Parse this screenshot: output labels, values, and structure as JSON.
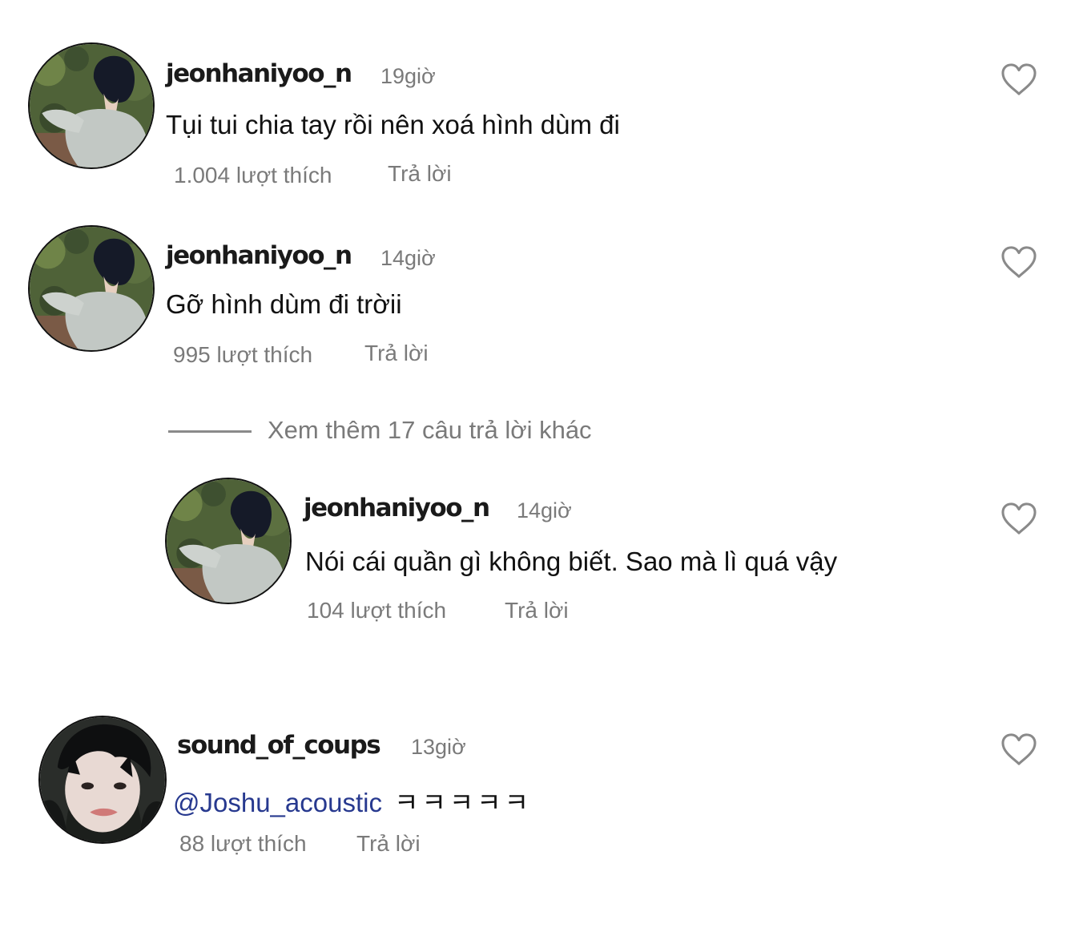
{
  "comments": [
    {
      "username": "jeonhaniyoo_n",
      "time": "19giờ",
      "text": "Tụi tui chia tay rồi nên xoá hình dùm đi",
      "likes": "1.004 lượt thích",
      "reply": "Trả lời",
      "avatar_icon": "avatar-photo-person-in-sweater",
      "like_icon": "heart-outline-icon"
    },
    {
      "username": "jeonhaniyoo_n",
      "time": "14giờ",
      "text": "Gỡ hình dùm đi trờii",
      "likes": "995 lượt thích",
      "reply": "Trả lời",
      "avatar_icon": "avatar-photo-person-in-sweater",
      "like_icon": "heart-outline-icon"
    },
    {
      "username": "jeonhaniyoo_n",
      "time": "14giờ",
      "text": "Nói cái quần gì không biết. Sao mà lì quá vậy",
      "likes": "104 lượt thích",
      "reply": "Trả lời",
      "avatar_icon": "avatar-photo-person-in-sweater",
      "like_icon": "heart-outline-icon"
    },
    {
      "username": "sound_of_coups",
      "time": "13giờ",
      "mention": "@Joshu_acoustic",
      "text": "ㅋㅋㅋㅋㅋ",
      "likes": "88 lượt thích",
      "reply": "Trả lời",
      "avatar_icon": "avatar-photo-face-closeup",
      "like_icon": "heart-outline-icon"
    }
  ],
  "view_more_replies": "Xem thêm 17 câu trả lời khác",
  "colors": {
    "mention": "#27398f",
    "secondary_text": "#7a7a7a",
    "primary_text": "#111111"
  }
}
